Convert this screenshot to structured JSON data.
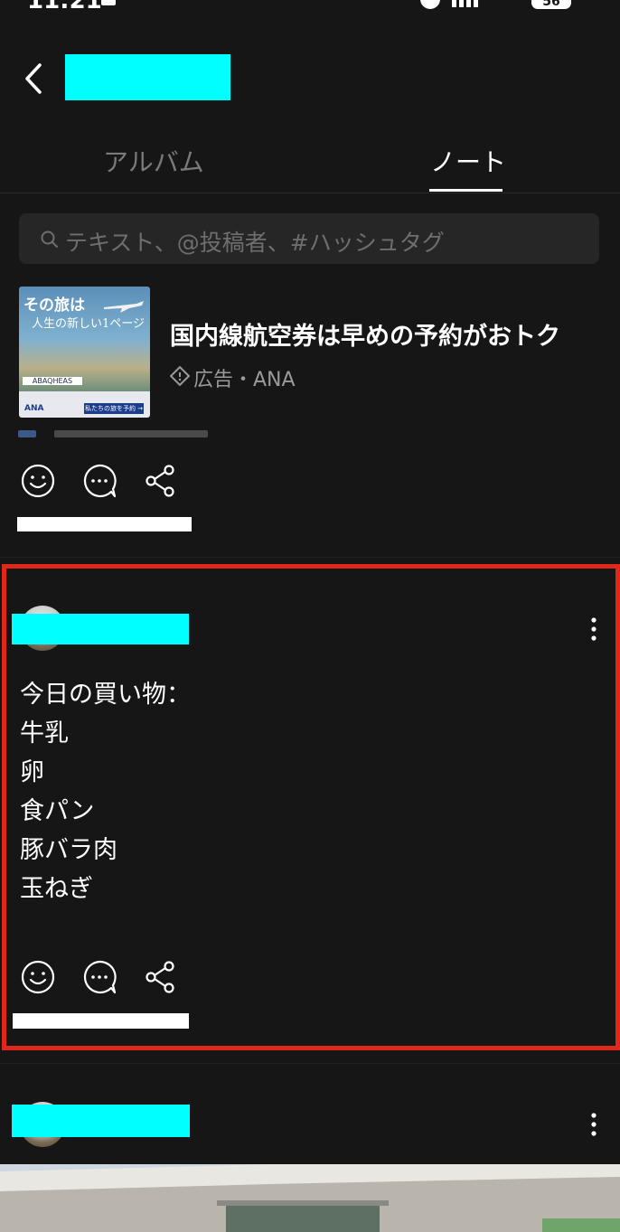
{
  "status_bar": {
    "time": "11:21",
    "battery": "56"
  },
  "header": {
    "back_label": "戻る"
  },
  "tabs": [
    {
      "label": "アルバム",
      "active": false
    },
    {
      "label": "ノート",
      "active": true
    }
  ],
  "search": {
    "placeholder": "テキスト、@投稿者、#ハッシュタグ"
  },
  "ad": {
    "image_text_1": "その旅は",
    "image_text_2": "人生の新しい1ページ",
    "image_band": "ABAQHEAS",
    "image_logo": "ANA",
    "image_button": "私たちの旅を予約 →",
    "title": "国内線航空券は早めの予約がおトク",
    "meta": "広告・ANA"
  },
  "highlighted_post": {
    "lines": [
      "今日の買い物：",
      "牛乳",
      "卵",
      "食パン",
      "豚バラ肉",
      "玉ねぎ"
    ]
  },
  "colors": {
    "background": "#161616",
    "highlight_border": "#e0281a",
    "redaction": "#00ffff"
  },
  "icons": [
    "back-arrow-icon",
    "search-icon",
    "info-diamond-icon",
    "smiley-icon",
    "comment-icon",
    "share-icon",
    "more-vertical-icon"
  ]
}
